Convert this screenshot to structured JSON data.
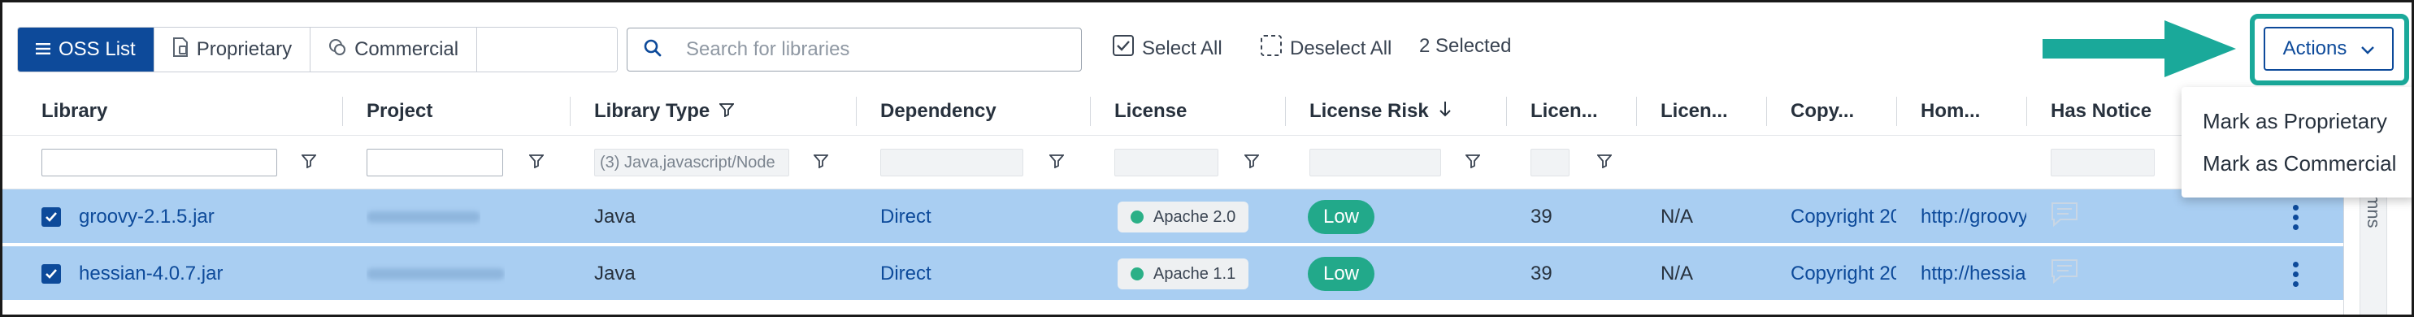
{
  "toolbar": {
    "tabs": [
      {
        "label": "OSS List",
        "icon": "list-icon",
        "active": true
      },
      {
        "label": "Proprietary",
        "icon": "document-icon",
        "active": false
      },
      {
        "label": "Commercial",
        "icon": "coins-icon",
        "active": false
      }
    ],
    "search_placeholder": "Search for libraries",
    "select_all": "Select All",
    "deselect_all": "Deselect All",
    "selected_count": "2 Selected",
    "actions_label": "Actions"
  },
  "menu": {
    "items": [
      "Mark as Proprietary",
      "Mark as Commercial"
    ]
  },
  "table": {
    "headers": {
      "library": "Library",
      "project": "Project",
      "library_type": "Library Type",
      "dependency": "Dependency",
      "license": "License",
      "license_risk": "License Risk",
      "licen1": "Licen...",
      "licen2": "Licen...",
      "copy": "Copy...",
      "hom": "Hom...",
      "has_notice": "Has Notice"
    },
    "filters": {
      "library_type_value": "(3) Java,javascript/Node"
    },
    "rows": [
      {
        "checked": true,
        "library": "groovy-2.1.5.jar",
        "library_type": "Java",
        "dependency": "Direct",
        "license": "Apache 2.0",
        "license_risk": "Low",
        "licen1": "39",
        "licen2": "N/A",
        "copy": "Copyright 20",
        "hom": "http://groovy"
      },
      {
        "checked": true,
        "library": "hessian-4.0.7.jar",
        "library_type": "Java",
        "dependency": "Direct",
        "license": "Apache 1.1",
        "license_risk": "Low",
        "licen1": "39",
        "licen2": "N/A",
        "copy": "Copyright 20",
        "hom": "http://hessia"
      }
    ]
  },
  "side_panel": {
    "label": "mns"
  },
  "colors": {
    "primary": "#0d4a9a",
    "selected_row": "#a9cef2",
    "risk_low": "#22a98a",
    "annotation": "#1aa99a"
  }
}
